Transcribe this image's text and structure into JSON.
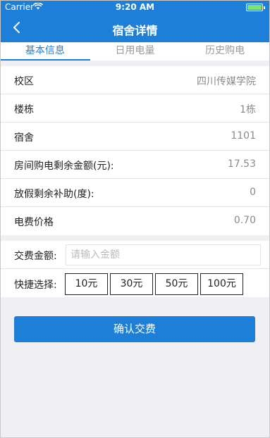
{
  "status_bar": {
    "carrier": "Carrier",
    "time": "9:20 AM"
  },
  "nav": {
    "title": "宿舍详情"
  },
  "tabs": [
    {
      "label": "基本信息",
      "active": true
    },
    {
      "label": "日用电量",
      "active": false
    },
    {
      "label": "历史购电",
      "active": false
    }
  ],
  "info": [
    {
      "label": "校区",
      "value": "四川传媒学院"
    },
    {
      "label": "楼栋",
      "value": "1栋"
    },
    {
      "label": "宿舍",
      "value": "1101"
    },
    {
      "label": "房间购电剩余金额(元):",
      "value": "17.53"
    },
    {
      "label": "放假剩余补助(度):",
      "value": "0"
    },
    {
      "label": "电费价格",
      "value": "0.70"
    }
  ],
  "payment": {
    "amount_label": "交费金额:",
    "amount_value": "",
    "amount_placeholder": "请输入金额",
    "quick_label": "快捷选择:",
    "quick_options": [
      "10元",
      "30元",
      "50元",
      "100元"
    ]
  },
  "confirm_label": "确认交费",
  "colors": {
    "accent": "#1d7fd8",
    "background": "#efeff4"
  }
}
